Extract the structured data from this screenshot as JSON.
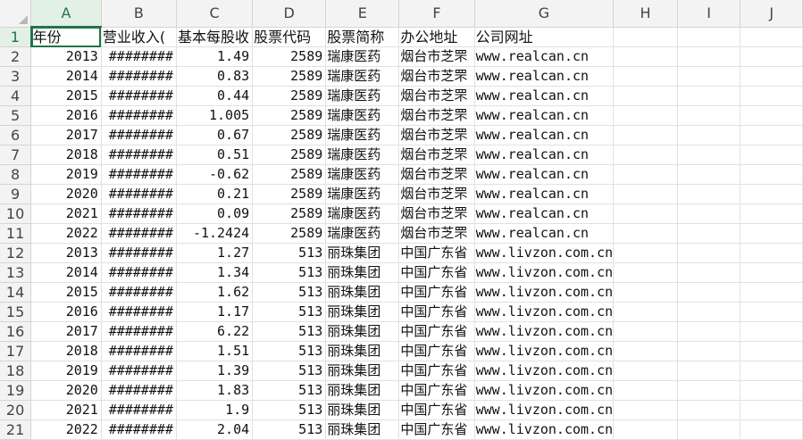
{
  "columns": [
    "A",
    "B",
    "C",
    "D",
    "E",
    "F",
    "G",
    "H",
    "I",
    "J"
  ],
  "header_row": {
    "row_num": "1",
    "A": "年份",
    "B": "营业收入(",
    "C": "基本每股收",
    "D": "股票代码",
    "E": "股票简称",
    "F": "办公地址",
    "G": "公司网址"
  },
  "rows": [
    {
      "n": "2",
      "A": "2013",
      "B": "########",
      "C": "1.49",
      "D": "2589",
      "E": "瑞康医药",
      "F": "烟台市芝罘",
      "G": "www.realcan.cn"
    },
    {
      "n": "3",
      "A": "2014",
      "B": "########",
      "C": "0.83",
      "D": "2589",
      "E": "瑞康医药",
      "F": "烟台市芝罘",
      "G": "www.realcan.cn"
    },
    {
      "n": "4",
      "A": "2015",
      "B": "########",
      "C": "0.44",
      "D": "2589",
      "E": "瑞康医药",
      "F": "烟台市芝罘",
      "G": "www.realcan.cn"
    },
    {
      "n": "5",
      "A": "2016",
      "B": "########",
      "C": "1.005",
      "D": "2589",
      "E": "瑞康医药",
      "F": "烟台市芝罘",
      "G": "www.realcan.cn"
    },
    {
      "n": "6",
      "A": "2017",
      "B": "########",
      "C": "0.67",
      "D": "2589",
      "E": "瑞康医药",
      "F": "烟台市芝罘",
      "G": "www.realcan.cn"
    },
    {
      "n": "7",
      "A": "2018",
      "B": "########",
      "C": "0.51",
      "D": "2589",
      "E": "瑞康医药",
      "F": "烟台市芝罘",
      "G": "www.realcan.cn"
    },
    {
      "n": "8",
      "A": "2019",
      "B": "########",
      "C": "-0.62",
      "D": "2589",
      "E": "瑞康医药",
      "F": "烟台市芝罘",
      "G": "www.realcan.cn"
    },
    {
      "n": "9",
      "A": "2020",
      "B": "########",
      "C": "0.21",
      "D": "2589",
      "E": "瑞康医药",
      "F": "烟台市芝罘",
      "G": "www.realcan.cn"
    },
    {
      "n": "10",
      "A": "2021",
      "B": "########",
      "C": "0.09",
      "D": "2589",
      "E": "瑞康医药",
      "F": "烟台市芝罘",
      "G": "www.realcan.cn"
    },
    {
      "n": "11",
      "A": "2022",
      "B": "########",
      "C": "-1.2424",
      "D": "2589",
      "E": "瑞康医药",
      "F": "烟台市芝罘",
      "G": "www.realcan.cn"
    },
    {
      "n": "12",
      "A": "2013",
      "B": "########",
      "C": "1.27",
      "D": "513",
      "E": "丽珠集团",
      "F": "中国广东省",
      "G": "www.livzon.com.cn"
    },
    {
      "n": "13",
      "A": "2014",
      "B": "########",
      "C": "1.34",
      "D": "513",
      "E": "丽珠集团",
      "F": "中国广东省",
      "G": "www.livzon.com.cn"
    },
    {
      "n": "14",
      "A": "2015",
      "B": "########",
      "C": "1.62",
      "D": "513",
      "E": "丽珠集团",
      "F": "中国广东省",
      "G": "www.livzon.com.cn"
    },
    {
      "n": "15",
      "A": "2016",
      "B": "########",
      "C": "1.17",
      "D": "513",
      "E": "丽珠集团",
      "F": "中国广东省",
      "G": "www.livzon.com.cn"
    },
    {
      "n": "16",
      "A": "2017",
      "B": "########",
      "C": "6.22",
      "D": "513",
      "E": "丽珠集团",
      "F": "中国广东省",
      "G": "www.livzon.com.cn"
    },
    {
      "n": "17",
      "A": "2018",
      "B": "########",
      "C": "1.51",
      "D": "513",
      "E": "丽珠集团",
      "F": "中国广东省",
      "G": "www.livzon.com.cn"
    },
    {
      "n": "18",
      "A": "2019",
      "B": "########",
      "C": "1.39",
      "D": "513",
      "E": "丽珠集团",
      "F": "中国广东省",
      "G": "www.livzon.com.cn"
    },
    {
      "n": "19",
      "A": "2020",
      "B": "########",
      "C": "1.83",
      "D": "513",
      "E": "丽珠集团",
      "F": "中国广东省",
      "G": "www.livzon.com.cn"
    },
    {
      "n": "20",
      "A": "2021",
      "B": "########",
      "C": "1.9",
      "D": "513",
      "E": "丽珠集团",
      "F": "中国广东省",
      "G": "www.livzon.com.cn"
    },
    {
      "n": "21",
      "A": "2022",
      "B": "########",
      "C": "2.04",
      "D": "513",
      "E": "丽珠集团",
      "F": "中国广东省",
      "G": "www.livzon.com.cn"
    }
  ],
  "selection": {
    "active_cell": "A1",
    "accent": "#217346"
  }
}
